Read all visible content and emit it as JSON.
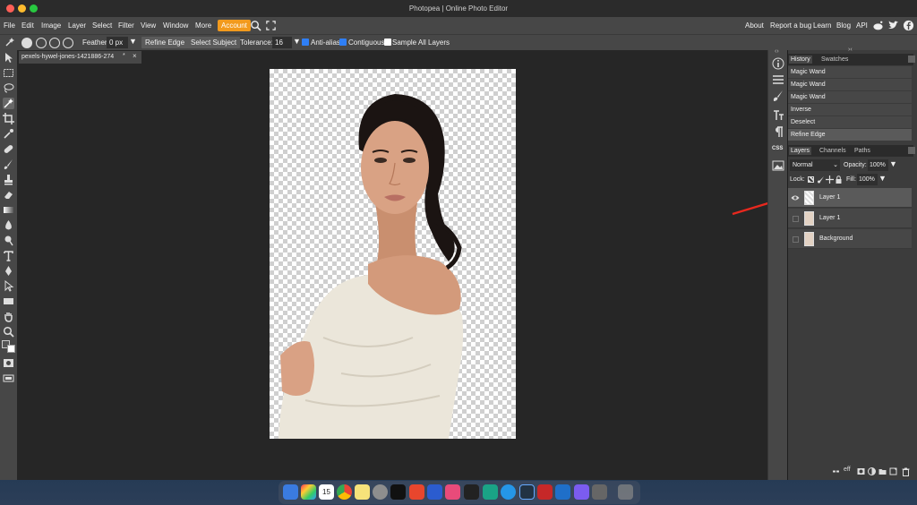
{
  "window": {
    "title": "Photopea | Online Photo Editor"
  },
  "menu": {
    "items": [
      "File",
      "Edit",
      "Image",
      "Layer",
      "Select",
      "Filter",
      "View",
      "Window",
      "More"
    ],
    "account_label": "Account",
    "right_items": [
      "About",
      "Report a bug",
      "Learn",
      "Blog",
      "API"
    ]
  },
  "options": {
    "feather_label": "Feather:",
    "feather_value": "0 px",
    "refine_edge_label": "Refine Edge",
    "select_subject_label": "Select Subject",
    "tolerance_label": "Tolerance:",
    "tolerance_value": "16",
    "anti_alias_label": "Anti-alias",
    "contiguous_label": "Contiguous",
    "sample_all_label": "Sample All Layers"
  },
  "document": {
    "tab_name": "pexels-hywel-jones-1421886-274",
    "modified_marker": "*"
  },
  "history": {
    "tabs": [
      "History",
      "Swatches"
    ],
    "items": [
      "Magic Wand",
      "Magic Wand",
      "Magic Wand",
      "Inverse",
      "Deselect",
      "Refine Edge"
    ]
  },
  "layers": {
    "tabs": [
      "Layers",
      "Channels",
      "Paths"
    ],
    "blend_mode": "Normal",
    "opacity_label": "Opacity:",
    "opacity_value": "100%",
    "lock_label": "Lock:",
    "fill_label": "Fill:",
    "fill_value": "100%",
    "items": [
      {
        "name": "Layer 1",
        "visible": true,
        "selected": true
      },
      {
        "name": "Layer 1",
        "visible": false,
        "selected": false
      },
      {
        "name": "Background",
        "visible": false,
        "selected": false
      }
    ]
  },
  "strip_text": {
    "css": "CSS"
  },
  "icons": {
    "search": "search-icon",
    "fullscreen": "fullscreen-icon",
    "reddit": "reddit-icon",
    "twitter": "twitter-icon",
    "facebook": "facebook-icon"
  },
  "colors": {
    "accent": "#f29a1d",
    "checkbox": "#2f7ff5",
    "annotation_arrow": "#e8281e"
  }
}
